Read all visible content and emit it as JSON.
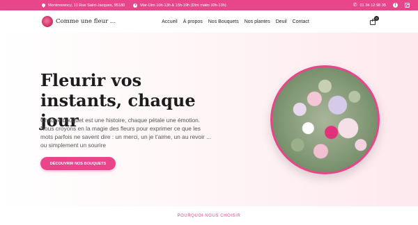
{
  "topbar": {
    "address": "Montmorency, 10 Rue Saint-Jacques, 95180",
    "hours": "Mar-Dim 10h-13h & 15h-19h (Dim matin 10h-13h)",
    "phone": "01 34 12 98 35"
  },
  "header": {
    "logo_text": "Comme une fleur ...",
    "nav": [
      "Accueil",
      "À propos",
      "Nos Bouquets",
      "Nos plantes",
      "Deuil",
      "Contact"
    ],
    "cart_count": "0"
  },
  "hero": {
    "title": "Fleurir vos instants, chaque jour",
    "text": "Chaque bouquet est une histoire, chaque pétale une émotion. Nous croyons en la magie des fleurs pour exprimer ce que les mots parfois ne savent dire : un merci, un je t'aime, un au revoir ... ou simplement un sourire",
    "button_label": "DÉCOUVRIR NOS BOUQUETS"
  },
  "section": {
    "heading": "POURQUOI NOUS CHOISIR"
  },
  "colors": {
    "accent": "#e8458b",
    "text_dark": "#1c1c1c"
  },
  "icons": {
    "address": "map-pin-icon",
    "hours": "clock-icon",
    "phone": "phone-icon",
    "facebook": "facebook-icon",
    "instagram": "instagram-icon",
    "cart": "shopping-bag-icon"
  }
}
